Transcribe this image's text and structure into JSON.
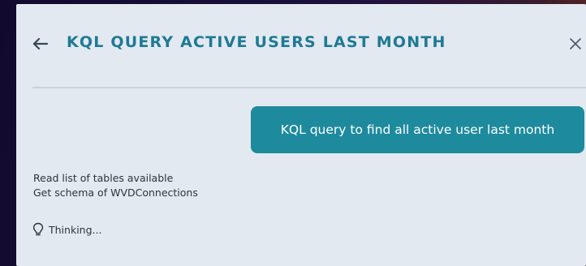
{
  "header": {
    "back_icon": "arrow-left-icon",
    "title": "KQL QUERY ACTIVE USERS LAST MONTH",
    "close_icon": "close-icon"
  },
  "conversation": {
    "user_message": "KQL query to find all active user last month",
    "steps": [
      {
        "label": "Read list of tables available"
      },
      {
        "label": "Get schema of WVDConnections"
      }
    ],
    "status": {
      "icon": "lightbulb-icon",
      "label": "Thinking..."
    }
  },
  "colors": {
    "accent": "#1e7a94",
    "bubble": "#1e8a9d",
    "panel_background": "#e3e9f1",
    "divider": "#c8d2df",
    "text": "#2a3440"
  }
}
